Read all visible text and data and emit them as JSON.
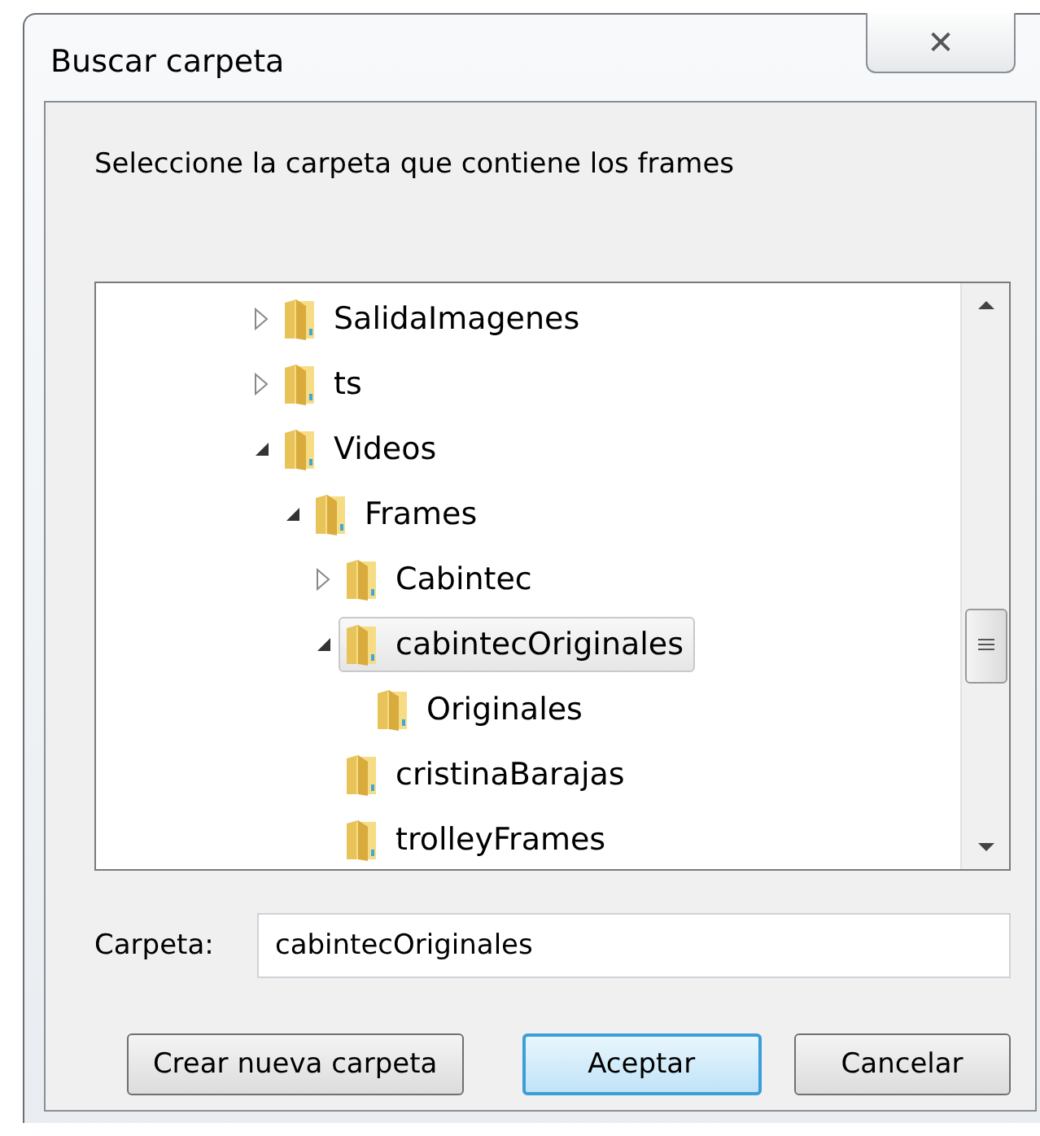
{
  "window": {
    "title": "Buscar carpeta",
    "close_label": "✕"
  },
  "instruction": "Seleccione la carpeta que contiene los frames",
  "tree": [
    {
      "label": "SalidaImagenes",
      "expanded": false,
      "selected": false
    },
    {
      "label": "ts",
      "expanded": false,
      "selected": false
    },
    {
      "label": "Videos",
      "expanded": true,
      "selected": false,
      "children": [
        {
          "label": "Frames",
          "expanded": true,
          "selected": false,
          "children": [
            {
              "label": "Cabintec",
              "expanded": false,
              "selected": false
            },
            {
              "label": "cabintecOriginales",
              "expanded": true,
              "selected": true,
              "children": [
                {
                  "label": "Originales",
                  "selected": false
                }
              ]
            },
            {
              "label": "cristinaBarajas",
              "selected": false
            },
            {
              "label": "trolleyFrames",
              "selected": false
            }
          ]
        }
      ]
    }
  ],
  "folder_field": {
    "label": "Carpeta:",
    "value": "cabintecOriginales"
  },
  "buttons": [
    {
      "label": "Crear nueva carpeta",
      "default": false
    },
    {
      "label": "Aceptar",
      "default": true
    },
    {
      "label": "Cancelar",
      "default": false
    }
  ]
}
